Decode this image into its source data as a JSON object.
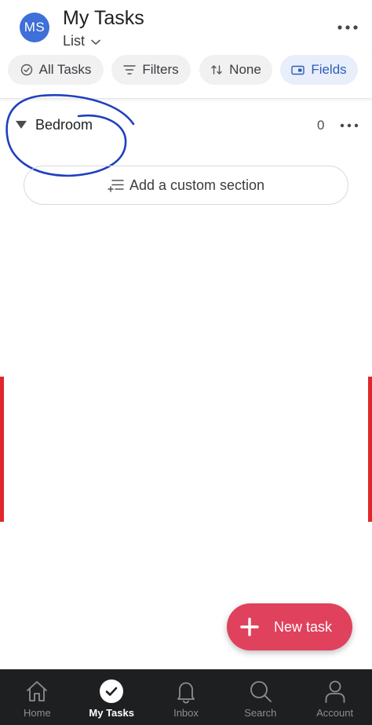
{
  "header": {
    "avatar_initials": "MS",
    "avatar_color": "#3f6fd8",
    "title": "My Tasks",
    "view_label": "List"
  },
  "toolbar": {
    "all_tasks": "All Tasks",
    "filters": "Filters",
    "sort": "None",
    "fields": "Fields"
  },
  "section": {
    "name": "Bedroom",
    "count": "0"
  },
  "add_section_label": "Add a custom section",
  "fab": {
    "label": "New task",
    "color": "#e0415d"
  },
  "nav": {
    "items": [
      {
        "label": "Home",
        "icon": "home-icon"
      },
      {
        "label": "My Tasks",
        "icon": "check-circle-icon",
        "active": true
      },
      {
        "label": "Inbox",
        "icon": "bell-icon"
      },
      {
        "label": "Search",
        "icon": "search-icon"
      },
      {
        "label": "Account",
        "icon": "person-icon"
      }
    ]
  },
  "colors": {
    "accent": "#2c5fb8",
    "annotation": "#1f3fbf",
    "edge_marks": "#e1262c"
  }
}
